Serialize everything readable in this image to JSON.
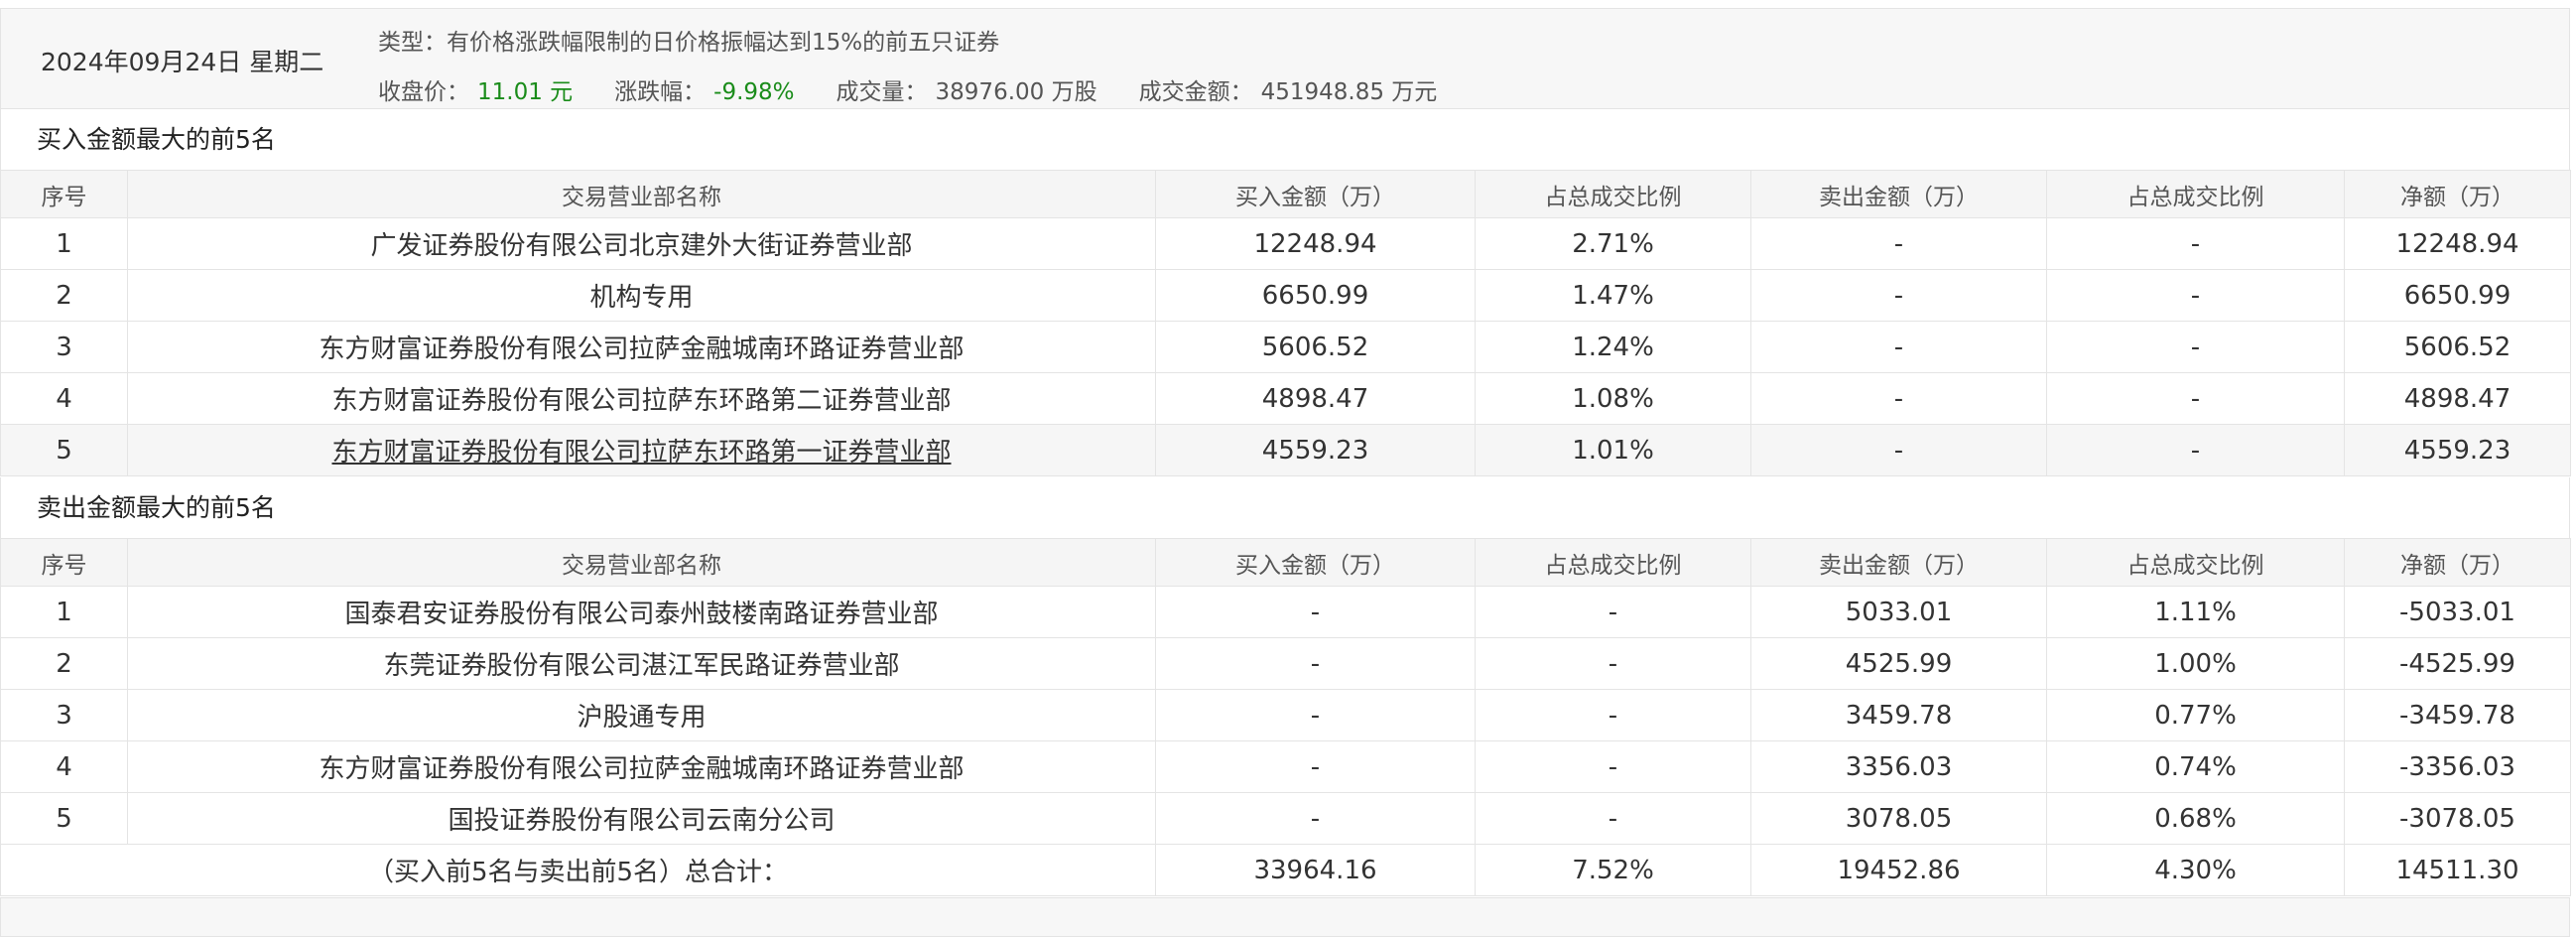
{
  "header": {
    "date": "2024年09月24日 星期二",
    "type_label": "类型：",
    "type_value": "有价格涨跌幅限制的日价格振幅达到15%的前五只证券",
    "close_label": "收盘价：",
    "close_value": "11.01 元",
    "change_label": "涨跌幅：",
    "change_value": "-9.98%",
    "volume_label": "成交量：",
    "volume_value": "38976.00 万股",
    "amount_label": "成交金额：",
    "amount_value": "451948.85 万元"
  },
  "columns": [
    "序号",
    "交易营业部名称",
    "买入金额（万）",
    "占总成交比例",
    "卖出金额（万）",
    "占总成交比例",
    "净额（万）"
  ],
  "buy": {
    "title": "买入金额最大的前5名",
    "rows": [
      {
        "idx": "1",
        "name": "广发证券股份有限公司北京建外大街证券营业部",
        "buy": "12248.94",
        "buy_pct": "2.71%",
        "sell": "-",
        "sell_pct": "-",
        "net": "12248.94"
      },
      {
        "idx": "2",
        "name": "机构专用",
        "buy": "6650.99",
        "buy_pct": "1.47%",
        "sell": "-",
        "sell_pct": "-",
        "net": "6650.99"
      },
      {
        "idx": "3",
        "name": "东方财富证券股份有限公司拉萨金融城南环路证券营业部",
        "buy": "5606.52",
        "buy_pct": "1.24%",
        "sell": "-",
        "sell_pct": "-",
        "net": "5606.52"
      },
      {
        "idx": "4",
        "name": "东方财富证券股份有限公司拉萨东环路第二证券营业部",
        "buy": "4898.47",
        "buy_pct": "1.08%",
        "sell": "-",
        "sell_pct": "-",
        "net": "4898.47"
      },
      {
        "idx": "5",
        "name": "东方财富证券股份有限公司拉萨东环路第一证券营业部",
        "buy": "4559.23",
        "buy_pct": "1.01%",
        "sell": "-",
        "sell_pct": "-",
        "net": "4559.23"
      }
    ]
  },
  "sell": {
    "title": "卖出金额最大的前5名",
    "rows": [
      {
        "idx": "1",
        "name": "国泰君安证券股份有限公司泰州鼓楼南路证券营业部",
        "buy": "-",
        "buy_pct": "-",
        "sell": "5033.01",
        "sell_pct": "1.11%",
        "net": "-5033.01"
      },
      {
        "idx": "2",
        "name": "东莞证券股份有限公司湛江军民路证券营业部",
        "buy": "-",
        "buy_pct": "-",
        "sell": "4525.99",
        "sell_pct": "1.00%",
        "net": "-4525.99"
      },
      {
        "idx": "3",
        "name": "沪股通专用",
        "buy": "-",
        "buy_pct": "-",
        "sell": "3459.78",
        "sell_pct": "0.77%",
        "net": "-3459.78"
      },
      {
        "idx": "4",
        "name": "东方财富证券股份有限公司拉萨金融城南环路证券营业部",
        "buy": "-",
        "buy_pct": "-",
        "sell": "3356.03",
        "sell_pct": "0.74%",
        "net": "-3356.03"
      },
      {
        "idx": "5",
        "name": "国投证券股份有限公司云南分公司",
        "buy": "-",
        "buy_pct": "-",
        "sell": "3078.05",
        "sell_pct": "0.68%",
        "net": "-3078.05"
      }
    ]
  },
  "total": {
    "label": "（买入前5名与卖出前5名）总合计：",
    "buy": "33964.16",
    "buy_pct": "7.52%",
    "sell": "19452.86",
    "sell_pct": "4.30%",
    "net": "14511.30"
  },
  "colors": {
    "up": "#d11010",
    "down": "#1a8c1a",
    "border": "#e4e4e4",
    "header_bg": "#f7f7f7"
  }
}
